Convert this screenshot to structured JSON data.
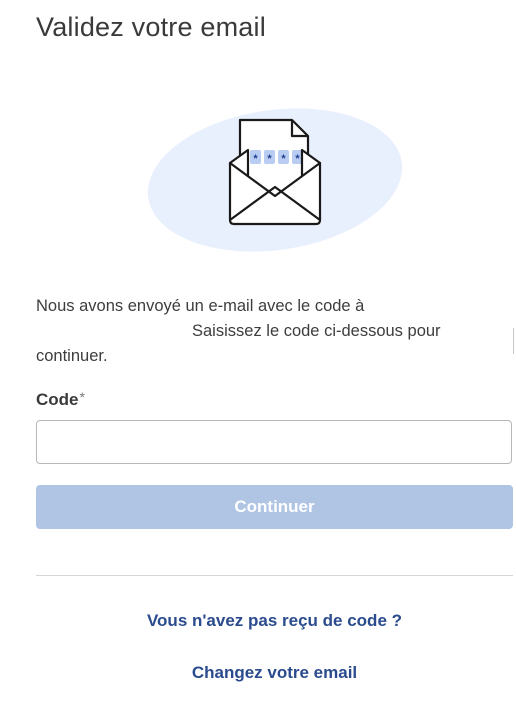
{
  "page": {
    "title": "Validez votre email"
  },
  "illustration": {
    "icon": "envelope-with-code-letter",
    "code_mask": [
      "*",
      "*",
      "*",
      "*"
    ],
    "colors": {
      "blob": "#e8effd",
      "outline": "#1a1a1a",
      "code_box": "#b9cdf3",
      "code_text": "#1f3f8f"
    }
  },
  "description": {
    "line1": "Nous avons envoyé un e-mail avec le code à",
    "line2": "Saisissez le code ci-dessous pour",
    "line3": "continuer."
  },
  "form": {
    "code_label": "Code",
    "required_mark": "*",
    "code_value": "",
    "submit_label": "Continuer"
  },
  "links": {
    "resend_label": "Vous n'avez pas reçu de code ?",
    "change_email_label": "Changez votre email"
  },
  "colors": {
    "link": "#2a4b8d",
    "button_disabled": "#b0c4e4",
    "button_text": "#ffffff"
  }
}
